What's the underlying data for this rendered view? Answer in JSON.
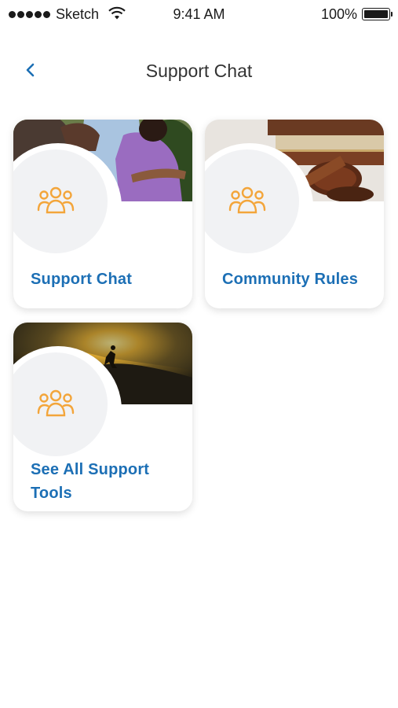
{
  "status_bar": {
    "carrier": "Sketch",
    "time": "9:41 AM",
    "battery_percent": "100%",
    "battery_level": 1.0
  },
  "nav": {
    "title": "Support Chat",
    "back_icon": "chevron-left-icon"
  },
  "colors": {
    "accent_blue": "#1c6fb5",
    "icon_orange": "#f3a53a",
    "circle_gray": "#f1f2f4"
  },
  "cards": [
    {
      "label": "Support Chat",
      "icon": "people-group-icon",
      "photo": "embracing-couple-photo"
    },
    {
      "label": "Community Rules",
      "icon": "people-group-icon",
      "photo": "books-and-gavel-photo"
    },
    {
      "label": "See All Support Tools",
      "icon": "people-group-icon",
      "photo": "climber-sunset-photo"
    }
  ]
}
